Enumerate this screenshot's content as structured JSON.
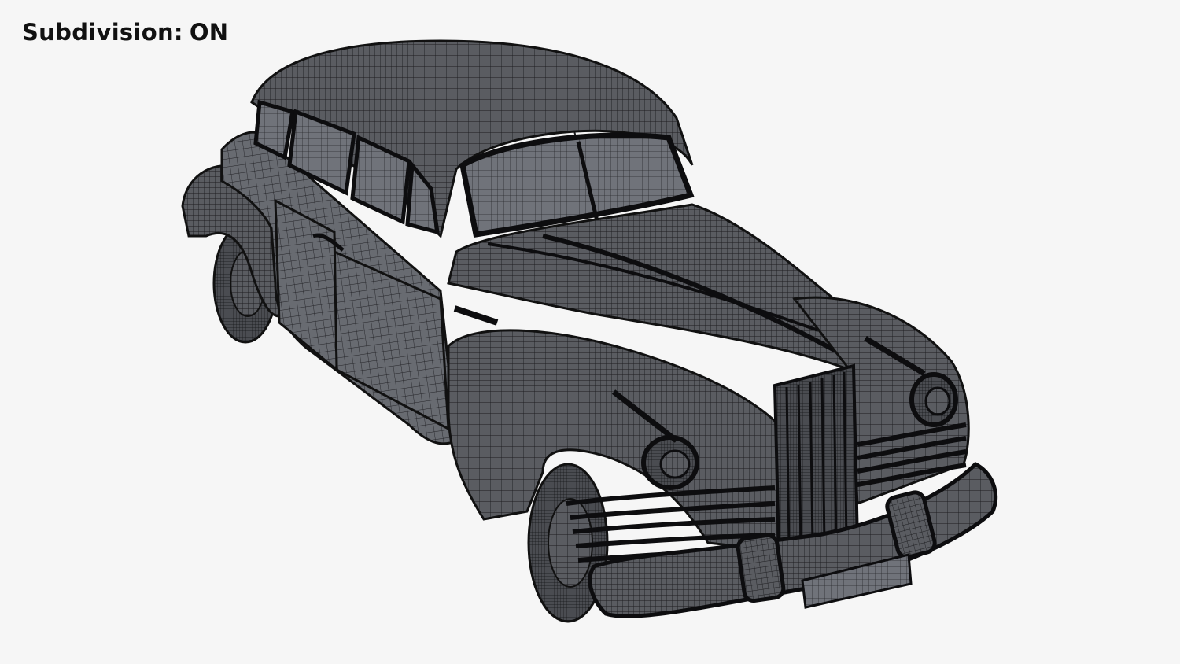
{
  "overlay": {
    "label": "Subdivision:",
    "state": "ON"
  },
  "scene": {
    "subject": "car-wireframe-model",
    "background_color": "#f6f6f6",
    "mesh_color": "#55575c",
    "wire_color": "#1a1a1c",
    "glass_color": "#6d7076"
  }
}
